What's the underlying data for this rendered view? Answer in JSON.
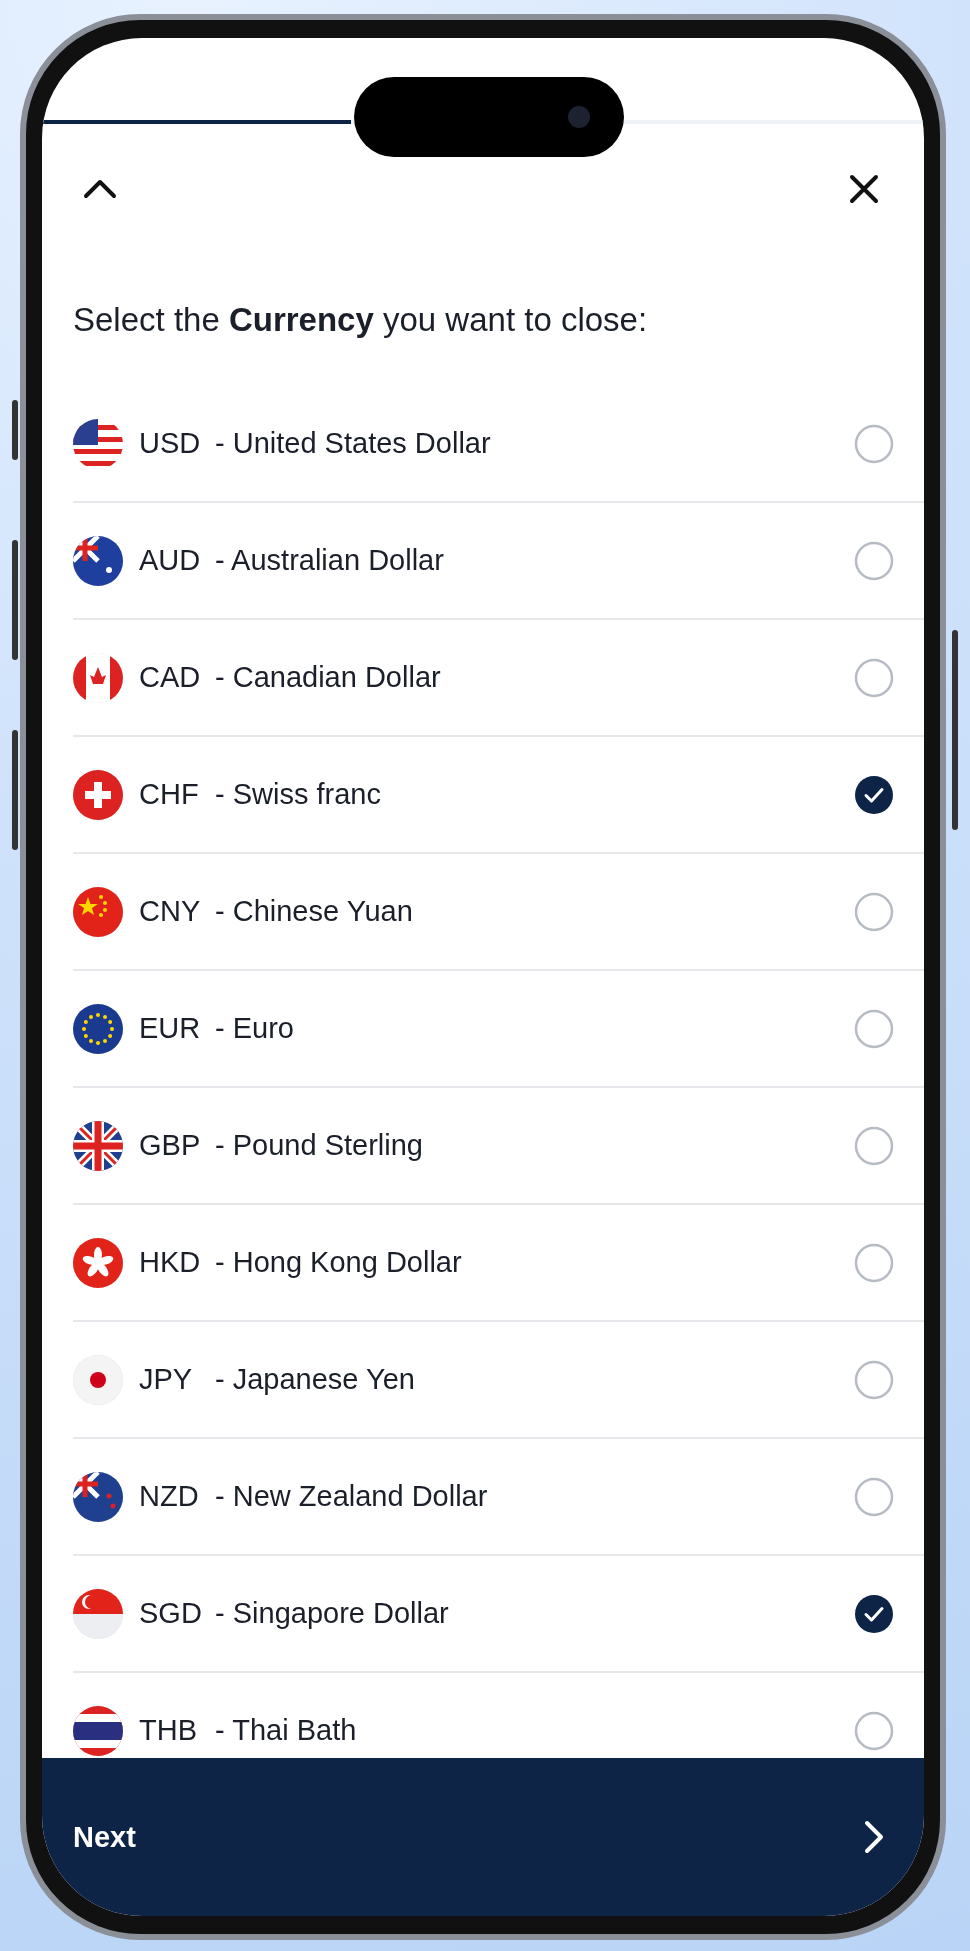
{
  "progress": {
    "level": 0.35
  },
  "title": "Select the **Currency** you want to close:",
  "currencies": [
    {
      "code": "USD",
      "name": "- United States Dollar",
      "selected": false
    },
    {
      "code": "AUD",
      "name": "- Australian Dollar",
      "selected": false
    },
    {
      "code": "CAD",
      "name": "- Canadian Dollar",
      "selected": false
    },
    {
      "code": "CHF",
      "name": "- Swiss franc",
      "selected": true
    },
    {
      "code": "CNY",
      "name": "- Chinese Yuan",
      "selected": false
    },
    {
      "code": "EUR",
      "name": "- Euro",
      "selected": false
    },
    {
      "code": "GBP",
      "name": "- Pound Sterling",
      "selected": false
    },
    {
      "code": "HKD",
      "name": "- Hong Kong Dollar",
      "selected": false
    },
    {
      "code": "JPY",
      "name": "- Japanese Yen",
      "selected": false
    },
    {
      "code": "NZD",
      "name": "- New Zealand Dollar",
      "selected": false
    },
    {
      "code": "SGD",
      "name": "- Singapore Dollar",
      "selected": true
    },
    {
      "code": "THB",
      "name": "- Thai Bath",
      "selected": false
    }
  ],
  "footer": {
    "label": "Next"
  }
}
